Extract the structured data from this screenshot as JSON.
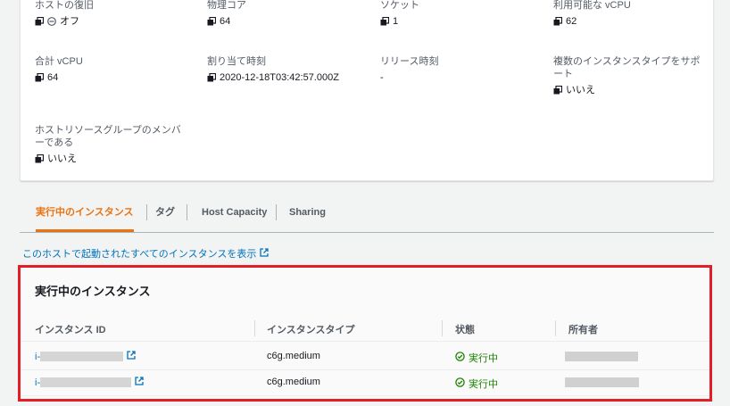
{
  "details": {
    "host_recovery": {
      "label": "ホストの復旧",
      "value": "オフ"
    },
    "physical_cores": {
      "label": "物理コア",
      "value": "64"
    },
    "sockets": {
      "label": "ソケット",
      "value": "1"
    },
    "available_vcpu": {
      "label": "利用可能な vCPU",
      "value": "62"
    },
    "total_vcpu": {
      "label": "合計 vCPU",
      "value": "64"
    },
    "allocation_time": {
      "label": "割り当て時刻",
      "value": "2020-12-18T03:42:57.000Z"
    },
    "release_time": {
      "label": "リリース時刻",
      "value": "-"
    },
    "multi_instance_type": {
      "label_line1": "複数のインスタンスタイプをサポ",
      "label_line2": "ート",
      "value": "いいえ"
    },
    "resource_group_member": {
      "label_line1": "ホストリソースグループのメンバ",
      "label_line2": "ーである",
      "value": "いいえ"
    }
  },
  "tabs": [
    {
      "label": "実行中のインスタンス",
      "active": true
    },
    {
      "label": "タグ",
      "active": false
    },
    {
      "label": "Host Capacity",
      "active": false
    },
    {
      "label": "Sharing",
      "active": false
    }
  ],
  "view_all_link": "このホストで起動されたすべてのインスタンスを表示",
  "instances": {
    "title": "実行中のインスタンス",
    "columns": [
      "インスタンス ID",
      "インスタンスタイプ",
      "状態",
      "所有者"
    ],
    "rows": [
      {
        "id_prefix": "i-",
        "type": "c6g.medium",
        "state": "実行中"
      },
      {
        "id_prefix": "i-",
        "type": "c6g.medium",
        "state": "実行中"
      }
    ]
  },
  "colors": {
    "accent": "#ec7211",
    "link": "#0073bb",
    "success": "#1d8102",
    "highlight": "#e41e26"
  }
}
